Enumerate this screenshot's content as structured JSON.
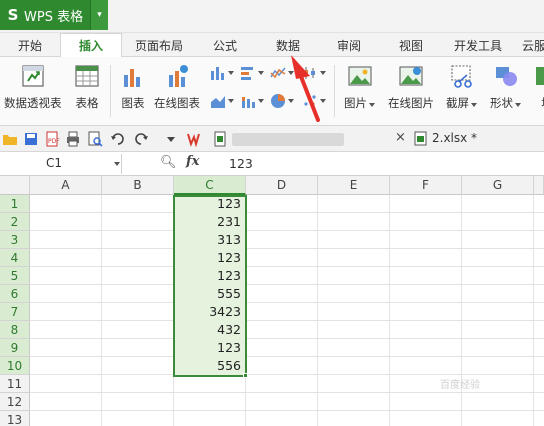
{
  "app": {
    "logo": "S",
    "name": "WPS 表格",
    "dropdown_glyph": "▾"
  },
  "tabs": [
    {
      "label": "开始",
      "active": false
    },
    {
      "label": "插入",
      "active": true
    },
    {
      "label": "页面布局",
      "active": false
    },
    {
      "label": "公式",
      "active": false
    },
    {
      "label": "数据",
      "active": false
    },
    {
      "label": "审阅",
      "active": false
    },
    {
      "label": "视图",
      "active": false
    },
    {
      "label": "开发工具",
      "active": false
    },
    {
      "label": "云服",
      "active": false
    }
  ],
  "ribbon": {
    "pivot_label": "数据透视表",
    "table_label": "表格",
    "chart_label": "图表",
    "online_chart_label": "在线图表",
    "picture_label": "图片",
    "online_picture_label": "在线图片",
    "screenshot_label": "截屏",
    "shape_label": "形状",
    "more_label": "地"
  },
  "quickbar": {
    "close_glyph": "×",
    "doc2_name": "2.xlsx *"
  },
  "formula_bar": {
    "cell_ref": "C1",
    "fx_label": "fx",
    "value": "123"
  },
  "sheet": {
    "columns": [
      "A",
      "B",
      "C",
      "D",
      "E",
      "F",
      "G"
    ],
    "selected_column": "C",
    "rows": [
      "1",
      "2",
      "3",
      "4",
      "5",
      "6",
      "7",
      "8",
      "9",
      "10",
      "11",
      "12",
      "13"
    ],
    "column_c_values": [
      "123",
      "231",
      "313",
      "123",
      "123",
      "555",
      "3423",
      "432",
      "123",
      "556"
    ]
  },
  "watermark": "百度经验",
  "colors": {
    "brand_green": "#2f8a2f",
    "selection_fill": "#e5f2de",
    "annotation_red": "#e8302a"
  }
}
